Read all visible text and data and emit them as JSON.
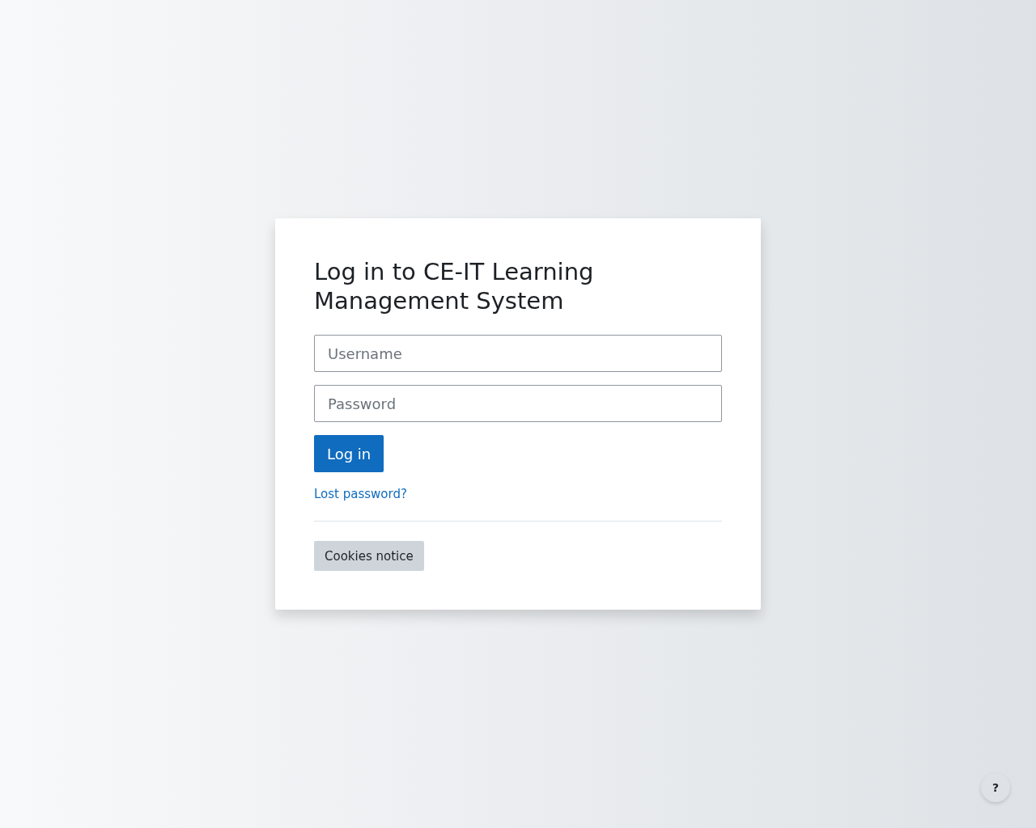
{
  "login": {
    "title": "Log in to CE-IT Learning Management System",
    "fields": [
      {
        "placeholder": "Username"
      },
      {
        "placeholder": "Password"
      }
    ],
    "submit": "Log in",
    "lost_password": "Lost password?",
    "cookies": "Cookies notice"
  },
  "help_button": "?"
}
